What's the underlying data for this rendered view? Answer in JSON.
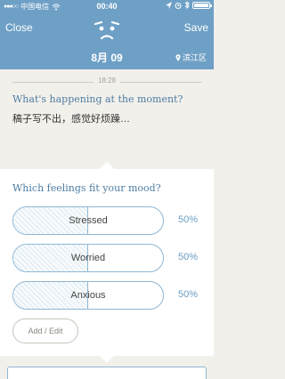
{
  "status_bar": {
    "carrier": "中国电信",
    "time": "00:40"
  },
  "header": {
    "close_label": "Close",
    "save_label": "Save",
    "date": "8月 09",
    "location": "滨江区"
  },
  "entry": {
    "time": "18:28",
    "question": "What's happening at the moment?",
    "text": "稿子写不出，感觉好烦躁…"
  },
  "feelings": {
    "question": "Which feelings fit your mood?",
    "items": [
      {
        "label": "Stressed",
        "percent_text": "50%",
        "level": 0.5
      },
      {
        "label": "Worried",
        "percent_text": "50%",
        "level": 0.5
      },
      {
        "label": "Anxious",
        "percent_text": "50%",
        "level": 0.5
      }
    ],
    "add_label": "Add / Edit"
  },
  "colors": {
    "header": "#6ea0c6",
    "accent": "#4d7da3",
    "bar_border": "#8eb7d4"
  }
}
